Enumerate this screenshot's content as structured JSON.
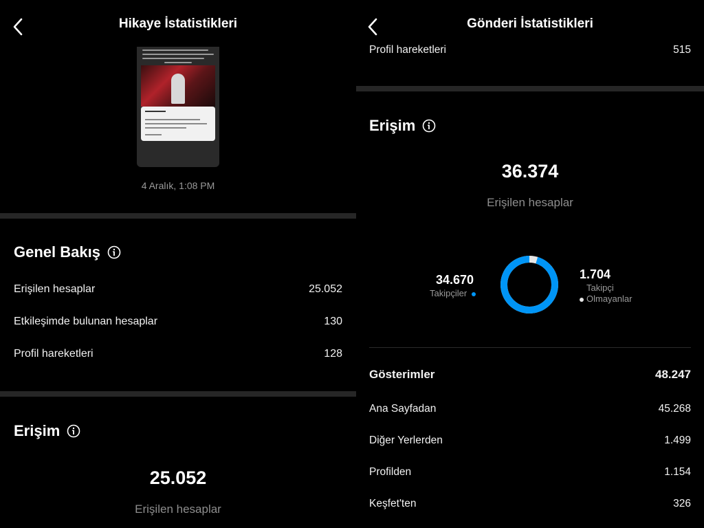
{
  "left": {
    "title": "Hikaye İstatistikleri",
    "story_date": "4 Aralık, 1:08 PM",
    "overview": {
      "title": "Genel Bakış",
      "rows": [
        {
          "label": "Erişilen hesaplar",
          "value": "25.052"
        },
        {
          "label": "Etkileşimde bulunan hesaplar",
          "value": "130"
        },
        {
          "label": "Profil hareketleri",
          "value": "128"
        }
      ]
    },
    "reach": {
      "title": "Erişim",
      "value": "25.052",
      "caption": "Erişilen hesaplar"
    }
  },
  "right": {
    "title": "Gönderi İstatistikleri",
    "profile_row": {
      "label": "Profil hareketleri",
      "value": "515"
    },
    "reach": {
      "title": "Erişim",
      "value": "36.374",
      "caption": "Erişilen hesaplar",
      "followers": {
        "value": "34.670",
        "label": "Takipçiler"
      },
      "non_followers": {
        "value": "1.704",
        "label_line1": "Takipçi",
        "label_line2": "Olmayanlar"
      },
      "follower_share": 0.953
    },
    "impressions": {
      "title": "Gösterimler",
      "total": "48.247",
      "rows": [
        {
          "label": "Ana Sayfadan",
          "value": "45.268"
        },
        {
          "label": "Diğer Yerlerden",
          "value": "1.499"
        },
        {
          "label": "Profilden",
          "value": "1.154"
        },
        {
          "label": "Keşfet'ten",
          "value": "326"
        }
      ]
    }
  },
  "colors": {
    "accent_blue": "#0095f6",
    "non_follower_white": "#e6e6e6",
    "divider": "#262626",
    "muted_text": "#8e8e8e"
  },
  "icons": {
    "back": "chevron-left-icon",
    "info": "info-circle-icon"
  }
}
